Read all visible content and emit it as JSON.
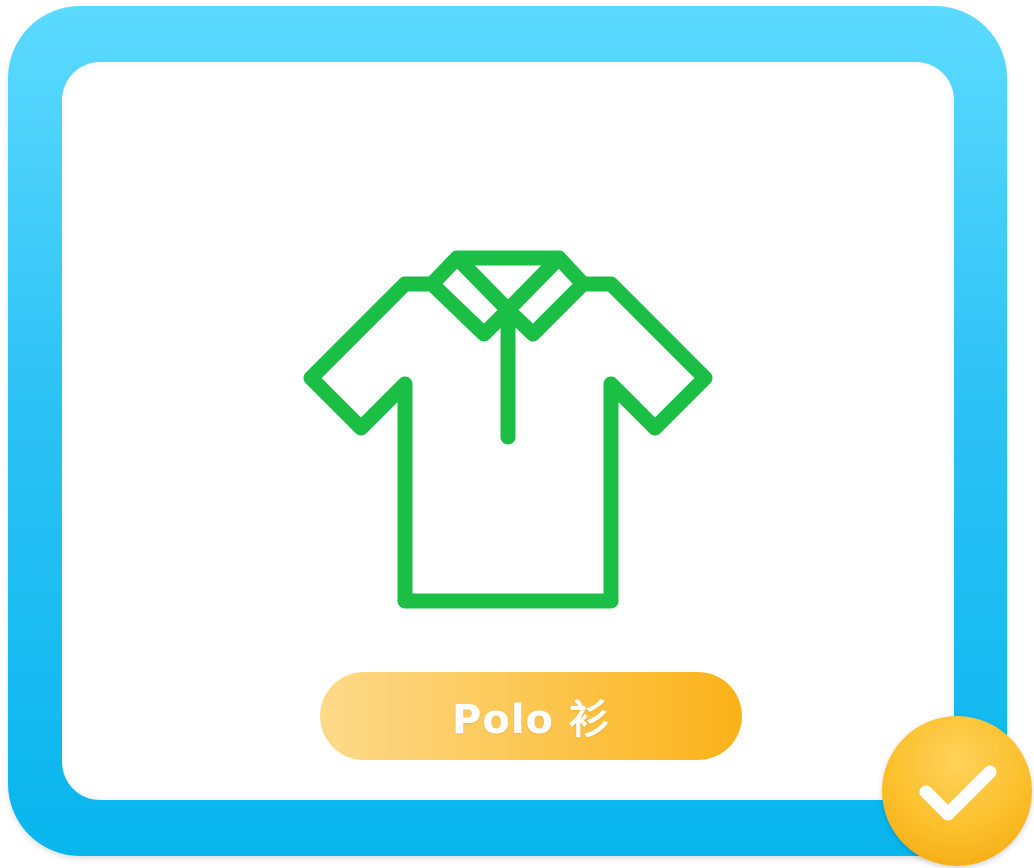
{
  "item": {
    "label": "Polo 衫",
    "selected": true
  },
  "icons": {
    "main": "polo-shirt-icon",
    "badge": "checkmark-icon"
  },
  "colors": {
    "frame": "#29C0F3",
    "shirt_stroke": "#1BBF45",
    "label_pill": "#FCC24A",
    "badge": "#FBBF2A"
  }
}
